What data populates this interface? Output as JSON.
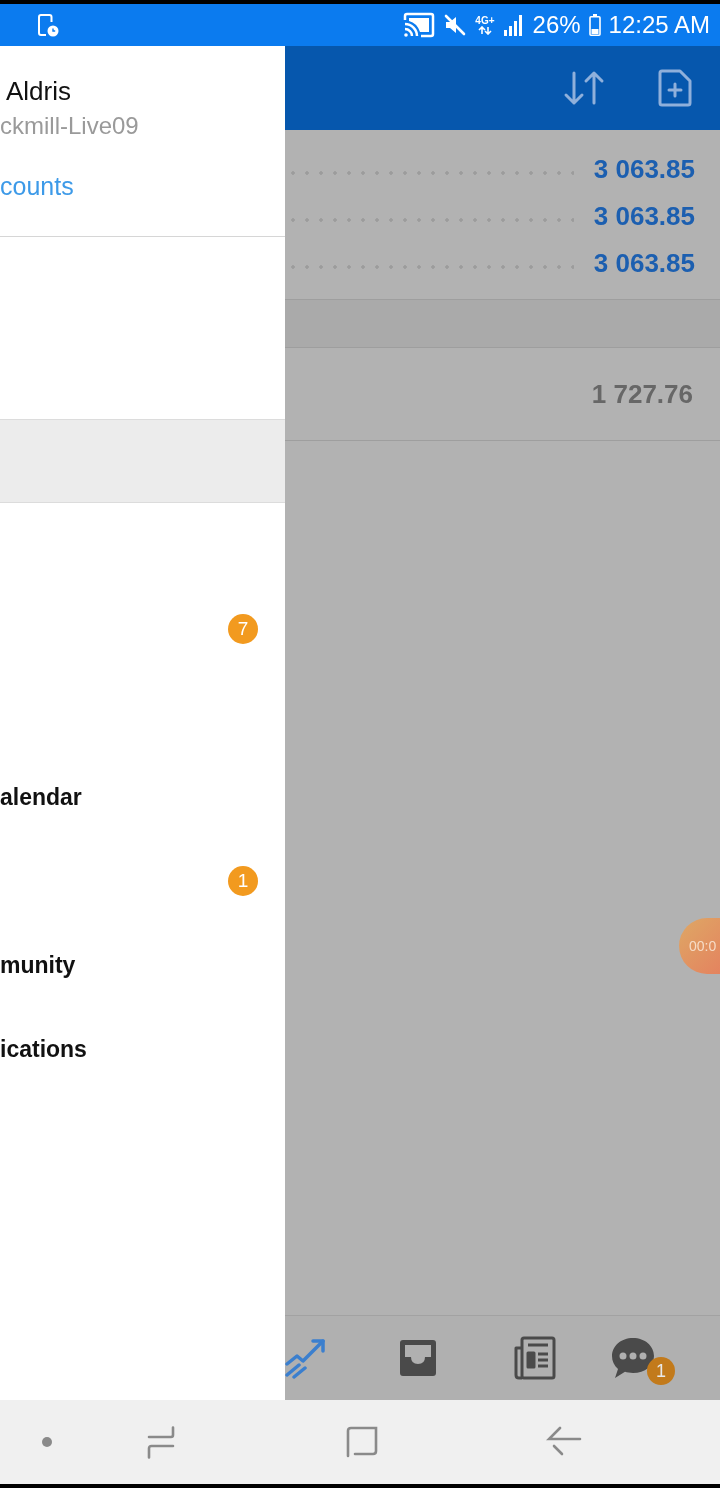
{
  "status_bar": {
    "network_type": "4G+",
    "battery": "26%",
    "time": "12:25 AM"
  },
  "drawer": {
    "account_name": "Aldris",
    "account_server": "ckmill-Live09",
    "accounts_link": "counts",
    "menu_items": [
      {
        "selected": false
      },
      {
        "selected": false
      },
      {
        "selected": true
      },
      {
        "selected": false
      },
      {
        "selected": false,
        "badge": "7"
      },
      {
        "selected": false
      },
      {
        "selected": false,
        "label": "alendar"
      },
      {
        "selected": false,
        "badge": "1"
      },
      {
        "selected": false,
        "label": "munity"
      },
      {
        "selected": false,
        "label": "ications"
      }
    ]
  },
  "main": {
    "summary_rows": [
      {
        "value": "3 063.85"
      },
      {
        "value": "3 063.85"
      },
      {
        "value": "3 063.85"
      }
    ],
    "detail_rows": [
      {
        "value": "1 727.76"
      }
    ]
  },
  "bottom_tabs": [
    {
      "kind": "trade",
      "selected": true
    },
    {
      "kind": "mailbox",
      "selected": false
    },
    {
      "kind": "news",
      "selected": false
    },
    {
      "kind": "chat",
      "selected": false,
      "badge": "1"
    }
  ],
  "recording_timer": "00:0"
}
